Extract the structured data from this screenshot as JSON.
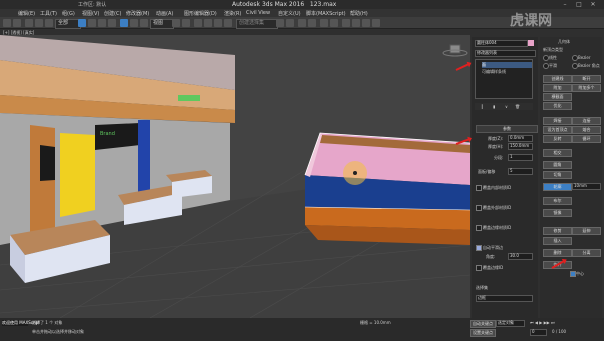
{
  "window": {
    "app_title": "Autodesk 3ds Max 2016",
    "file_name": "123.max",
    "workspace": "工作区: 默认",
    "logo_text": "虎课网"
  },
  "menu": [
    "编辑(E)",
    "工具(T)",
    "组(G)",
    "视图(V)",
    "创建(C)",
    "修改器(M)",
    "动画(A)",
    "图形编辑器(D)",
    "渲染(R)",
    "Civil View",
    "自定义(U)",
    "脚本(MAXScript)",
    "帮助(H)"
  ],
  "toolbar": {
    "filter_value": "全部",
    "view_value": "视图",
    "selection_set_placeholder": "创建选择集"
  },
  "viewport": {
    "label": "[+] [透视] [真实]",
    "sign_text": "Brand"
  },
  "modifier_panel": {
    "object_name": "圆柱体004",
    "list_label": "修改器列表",
    "stack_items": [
      "面",
      "可编辑样条线"
    ],
    "params_title": "参数",
    "thickness_label": "厚度(Z):",
    "thickness_value": "0.0mm",
    "height_label": "厚度(H):",
    "height_value": "150.0mm",
    "segments_label": "分段:",
    "segments_value": "1",
    "cap_label": "面板/偏移",
    "cap_value": "5",
    "chk_labels": [
      "覆盖内部材质ID",
      "覆盖外部材质ID",
      "覆盖边缘材质ID",
      "自动平滑边",
      "覆盖边缘ID"
    ],
    "smooth_label": "角度:",
    "smooth_value": "30.0",
    "bottom_label": "选择集",
    "bottom_value": "边框"
  },
  "geometry_panel": {
    "section_title": "几何体",
    "interp_label": "新顶点类型",
    "types": [
      "线性",
      "平滑",
      "Bezier",
      "Bezier 角点"
    ],
    "buttons": [
      "创建线",
      "断开",
      "附加",
      "附加多个",
      "横截面",
      "优化",
      "焊接",
      "连接",
      "设为首顶点",
      "熔合",
      "反转",
      "循环",
      "相交",
      "圆角",
      "切角",
      "轮廓",
      "布尔",
      "镜像",
      "修剪",
      "延伸",
      "插入",
      "删除",
      "分离",
      "炸开"
    ],
    "outline_value": "10mm",
    "center_label": "中心"
  },
  "status": {
    "selection_text": "选择了 1 个 对象",
    "prompt_text": "单击并拖动以选择并移动对象",
    "welcome": "欢迎使用 MAXScript",
    "grid_value": "栅格 = 10.0mm",
    "key_label": "自动关键点",
    "set_key_label": "设置关键点",
    "selected_label": "选定对象",
    "frame_value": "0 / 100",
    "frame_current": "0"
  },
  "colors": {
    "accent_pink": "#e9a3c9",
    "floor_blue": "#1a3f8f",
    "orange": "#c96a1e",
    "red_arrow": "#e02020"
  }
}
